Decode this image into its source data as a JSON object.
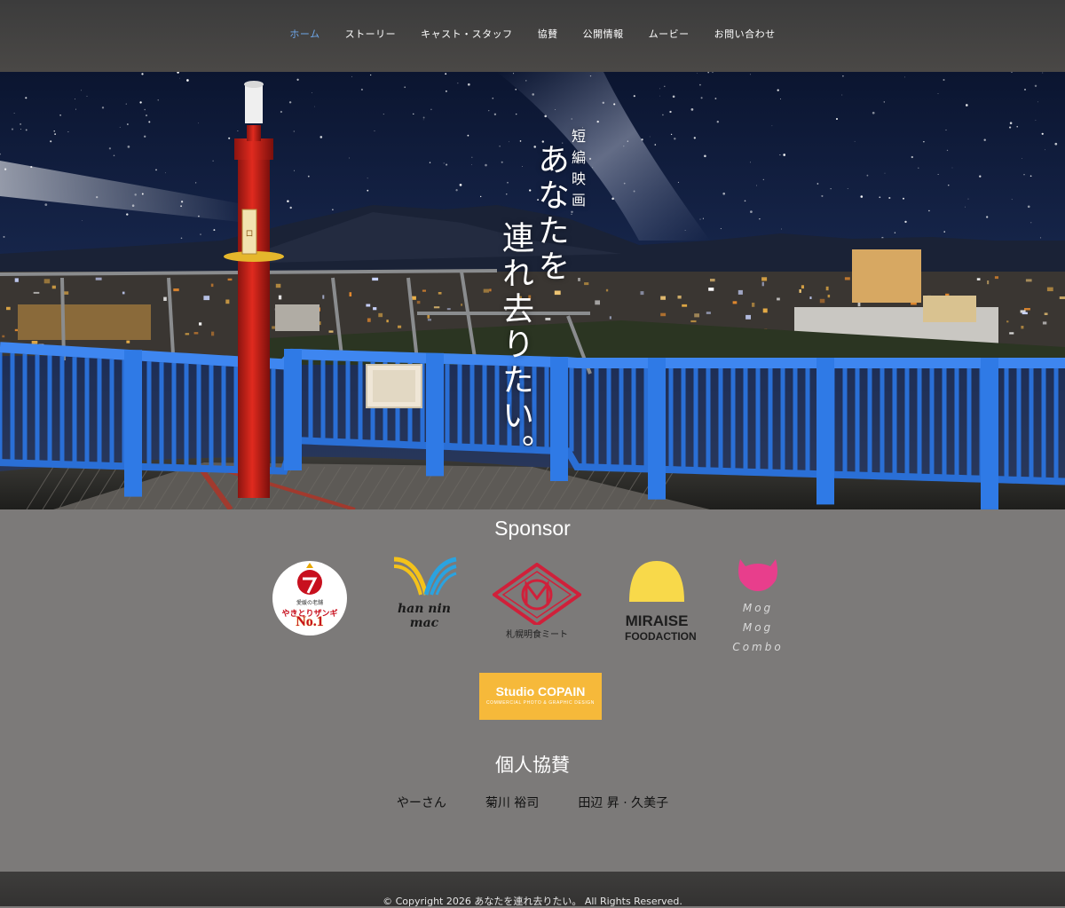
{
  "nav": {
    "items": [
      {
        "label": "ホーム",
        "active": true
      },
      {
        "label": "ストーリー"
      },
      {
        "label": "キャスト・スタッフ"
      },
      {
        "label": "協賛"
      },
      {
        "label": "公開情報"
      },
      {
        "label": "ムービー"
      },
      {
        "label": "お問い合わせ"
      }
    ],
    "active_color": "#6ea6e8"
  },
  "hero": {
    "subtitle": "短編映画",
    "title_line1": "あなたを",
    "title_line2": "連れ去りたい。",
    "board_label": "ロ"
  },
  "sponsors": {
    "heading": "Sponsor",
    "items": [
      {
        "name": "yakitori-logo",
        "caption_small": "愛媛の老舗",
        "caption_main": "やきとりザンギ",
        "badge": "No.1"
      },
      {
        "name": "hanninmac-logo",
        "text": "han nin mac"
      },
      {
        "name": "sapporo-meishoku-logo",
        "caption": "札幌明食ミート"
      },
      {
        "name": "miraise-logo",
        "line1": "MIRAISE",
        "line2": "FOODACTION"
      },
      {
        "name": "mogmog-logo",
        "text": "Mog Mog Combo"
      },
      {
        "name": "studio-copain-logo",
        "line1": "Studio COPAIN",
        "line2": "COMMERCIAL PHOTO & GRAPHIC DESIGN"
      }
    ],
    "colors": {
      "copain_bg": "#f6b93a",
      "miraise_yellow": "#f8d94a",
      "mogmog_pink": "#e83e8c",
      "meishoku_red": "#d0203a"
    }
  },
  "individual": {
    "heading": "個人協賛",
    "names": [
      "やーさん",
      "菊川 裕司",
      "田辺 昇 · 久美子"
    ]
  },
  "footer": {
    "copyright": "© Copyright 2026 あなたを連れ去りたい。 All Rights Reserved."
  }
}
